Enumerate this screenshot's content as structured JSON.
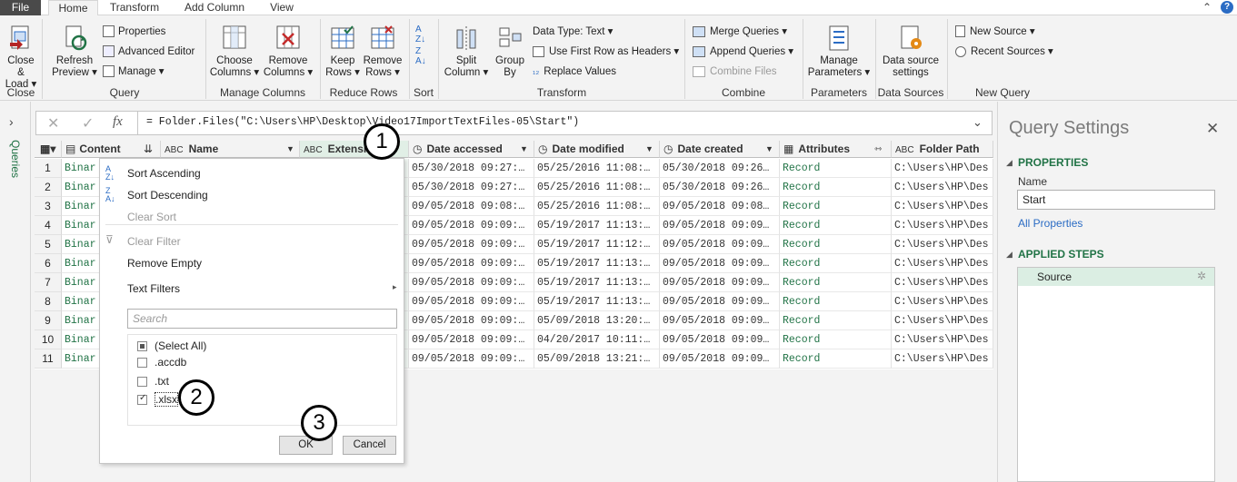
{
  "tabs": [
    "File",
    "Home",
    "Transform",
    "Add Column",
    "View"
  ],
  "ribbon": {
    "groups": {
      "close": "Close",
      "query": "Query",
      "manage_columns": "Manage Columns",
      "reduce_rows": "Reduce Rows",
      "sort": "Sort",
      "transform": "Transform",
      "combine": "Combine",
      "parameters": "Parameters",
      "data_sources": "Data Sources",
      "new_query": "New Query"
    },
    "close_load": [
      "Close &",
      "Load ▾"
    ],
    "refresh_preview": [
      "Refresh",
      "Preview ▾"
    ],
    "properties": "Properties",
    "advanced_editor": "Advanced Editor",
    "manage": "Manage ▾",
    "choose_columns": [
      "Choose",
      "Columns ▾"
    ],
    "remove_columns": [
      "Remove",
      "Columns ▾"
    ],
    "keep_rows": [
      "Keep",
      "Rows ▾"
    ],
    "remove_rows": [
      "Remove",
      "Rows ▾"
    ],
    "split_column": [
      "Split",
      "Column ▾"
    ],
    "group_by": [
      "Group",
      "By"
    ],
    "data_type": "Data Type: Text ▾",
    "use_first_row": "Use First Row as Headers ▾",
    "replace_values": "Replace Values",
    "merge_queries": "Merge Queries ▾",
    "append_queries": "Append Queries ▾",
    "combine_files": "Combine Files",
    "manage_parameters": [
      "Manage",
      "Parameters ▾"
    ],
    "data_source_settings": [
      "Data source",
      "settings"
    ],
    "new_source": "New Source ▾",
    "recent_sources": "Recent Sources ▾"
  },
  "left_pane_label": "Queries",
  "formula": "= Folder.Files(\"C:\\Users\\HP\\Desktop\\Video17ImportTextFiles-05\\Start\")",
  "columns": [
    "Content",
    "Name",
    "Extension",
    "Date accessed",
    "Date modified",
    "Date created",
    "Attributes",
    "Folder Path"
  ],
  "rows": [
    {
      "n": "1",
      "content": "Binar",
      "accessed": "05/30/2018 09:27:…",
      "modified": "05/25/2016 11:08:…",
      "created": "05/30/2018 09:26…",
      "attr": "Record",
      "path": "C:\\Users\\HP\\Des"
    },
    {
      "n": "2",
      "content": "Binar",
      "accessed": "05/30/2018 09:27:…",
      "modified": "05/25/2016 11:08:…",
      "created": "05/30/2018 09:26…",
      "attr": "Record",
      "path": "C:\\Users\\HP\\Des"
    },
    {
      "n": "3",
      "content": "Binar",
      "accessed": "09/05/2018 09:08:…",
      "modified": "05/25/2016 11:08:…",
      "created": "09/05/2018 09:08…",
      "attr": "Record",
      "path": "C:\\Users\\HP\\Des"
    },
    {
      "n": "4",
      "content": "Binar",
      "accessed": "09/05/2018 09:09:…",
      "modified": "05/19/2017 11:13:…",
      "created": "09/05/2018 09:09…",
      "attr": "Record",
      "path": "C:\\Users\\HP\\Des"
    },
    {
      "n": "5",
      "content": "Binar",
      "accessed": "09/05/2018 09:09:…",
      "modified": "05/19/2017 11:12:…",
      "created": "09/05/2018 09:09…",
      "attr": "Record",
      "path": "C:\\Users\\HP\\Des"
    },
    {
      "n": "6",
      "content": "Binar",
      "accessed": "09/05/2018 09:09:…",
      "modified": "05/19/2017 11:13:…",
      "created": "09/05/2018 09:09…",
      "attr": "Record",
      "path": "C:\\Users\\HP\\Des"
    },
    {
      "n": "7",
      "content": "Binar",
      "accessed": "09/05/2018 09:09:…",
      "modified": "05/19/2017 11:13:…",
      "created": "09/05/2018 09:09…",
      "attr": "Record",
      "path": "C:\\Users\\HP\\Des"
    },
    {
      "n": "8",
      "content": "Binar",
      "accessed": "09/05/2018 09:09:…",
      "modified": "05/19/2017 11:13:…",
      "created": "09/05/2018 09:09…",
      "attr": "Record",
      "path": "C:\\Users\\HP\\Des"
    },
    {
      "n": "9",
      "content": "Binar",
      "accessed": "09/05/2018 09:09:…",
      "modified": "05/09/2018 13:20:…",
      "created": "09/05/2018 09:09…",
      "attr": "Record",
      "path": "C:\\Users\\HP\\Des"
    },
    {
      "n": "10",
      "content": "Binar",
      "accessed": "09/05/2018 09:09:…",
      "modified": "04/20/2017 10:11:…",
      "created": "09/05/2018 09:09…",
      "attr": "Record",
      "path": "C:\\Users\\HP\\Des"
    },
    {
      "n": "11",
      "content": "Binar",
      "accessed": "09/05/2018 09:09:…",
      "modified": "05/09/2018 13:21:…",
      "created": "09/05/2018 09:09…",
      "attr": "Record",
      "path": "C:\\Users\\HP\\Des"
    }
  ],
  "dropdown": {
    "sort_asc": "Sort Ascending",
    "sort_desc": "Sort Descending",
    "clear_sort": "Clear Sort",
    "clear_filter": "Clear Filter",
    "remove_empty": "Remove Empty",
    "text_filters": "Text Filters",
    "search_placeholder": "Search",
    "values": [
      {
        "label": "(Select All)",
        "state": "partial"
      },
      {
        "label": ".accdb",
        "state": "unchecked"
      },
      {
        "label": ".txt",
        "state": "unchecked"
      },
      {
        "label": ".xlsx",
        "state": "checked"
      }
    ],
    "ok": "OK",
    "cancel": "Cancel"
  },
  "callouts": [
    "1",
    "2",
    "3"
  ],
  "query_settings": {
    "title": "Query Settings",
    "properties": "PROPERTIES",
    "name_label": "Name",
    "name_value": "Start",
    "all_properties": "All Properties",
    "applied_steps": "APPLIED STEPS",
    "steps": [
      "Source"
    ]
  },
  "colors": {
    "accent": "#217346",
    "selected_step": "#dbeee3",
    "highlight_col": "#e1efe6"
  }
}
